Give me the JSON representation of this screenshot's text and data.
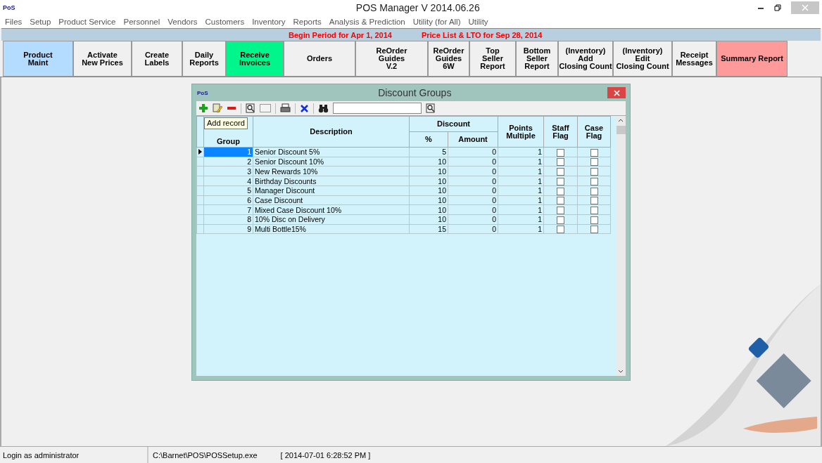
{
  "window": {
    "logo": "PoS",
    "title": "POS Manager V 2014.06.26"
  },
  "menu": [
    "Files",
    "Setup",
    "Product Service",
    "Personnel",
    "Vendors",
    "Customers",
    "Inventory",
    "Reports",
    "Analysis & Prediction",
    "Utility (for All)",
    "Utility"
  ],
  "period_banner": [
    "Begin Period for  Apr 1, 2014",
    "Price List & LTO for  Sep 28, 2014"
  ],
  "buttons": [
    {
      "lines": [
        "Product",
        "Maint"
      ],
      "color": "#b3dcff"
    },
    {
      "lines": [
        "Activate",
        "New Prices"
      ],
      "color": "#f0f0f0"
    },
    {
      "lines": [
        "Create",
        "Labels"
      ],
      "color": "#f0f0f0"
    },
    {
      "lines": [
        "Daily",
        "Reports"
      ],
      "color": "#f0f0f0"
    },
    {
      "lines": [
        "Receive",
        "Invoices"
      ],
      "color": "#00f58a"
    },
    {
      "lines": [
        "Orders"
      ],
      "color": "#f0f0f0"
    },
    {
      "lines": [
        "ReOrder",
        "Guides",
        "V.2"
      ],
      "color": "#f0f0f0"
    },
    {
      "lines": [
        "ReOrder",
        "Guides",
        "6W"
      ],
      "color": "#f0f0f0"
    },
    {
      "lines": [
        "Top",
        "Seller",
        "Report"
      ],
      "color": "#f0f0f0"
    },
    {
      "lines": [
        "Bottom",
        "Seller",
        "Report"
      ],
      "color": "#f0f0f0"
    },
    {
      "lines": [
        "(Inventory)",
        "Add",
        "Closing Count"
      ],
      "color": "#f0f0f0"
    },
    {
      "lines": [
        "(Inventory)",
        "Edit",
        "Closing Count"
      ],
      "color": "#f0f0f0"
    },
    {
      "lines": [
        "Receipt",
        "Messages"
      ],
      "color": "#f0f0f0"
    },
    {
      "lines": [
        "Summary Report"
      ],
      "color": "#ff9a9a"
    }
  ],
  "dialog": {
    "logo": "PoS",
    "title": "Discount Groups",
    "tooltip": "Add record",
    "columns": {
      "group": "Group",
      "description": "Description",
      "discount": "Discount",
      "percent": "%",
      "amount": "Amount",
      "points": "Points Multiple",
      "staff": "Staff Flag",
      "case": "Case Flag"
    },
    "rows": [
      {
        "group": "1",
        "description": "Senior Discount 5%",
        "percent": "5",
        "amount": "0",
        "points": "1",
        "staff_flag": false,
        "case_flag": false,
        "selected": true
      },
      {
        "group": "2",
        "description": "Senior Discount 10%",
        "percent": "10",
        "amount": "0",
        "points": "1",
        "staff_flag": false,
        "case_flag": false,
        "selected": false
      },
      {
        "group": "3",
        "description": "New Rewards 10%",
        "percent": "10",
        "amount": "0",
        "points": "1",
        "staff_flag": false,
        "case_flag": false,
        "selected": false
      },
      {
        "group": "4",
        "description": "Birthday Discounts",
        "percent": "10",
        "amount": "0",
        "points": "1",
        "staff_flag": false,
        "case_flag": false,
        "selected": false
      },
      {
        "group": "5",
        "description": "Manager Discount",
        "percent": "10",
        "amount": "0",
        "points": "1",
        "staff_flag": false,
        "case_flag": false,
        "selected": false
      },
      {
        "group": "6",
        "description": "Case Discount",
        "percent": "10",
        "amount": "0",
        "points": "1",
        "staff_flag": false,
        "case_flag": false,
        "selected": false
      },
      {
        "group": "7",
        "description": "Mixed Case Discount 10%",
        "percent": "10",
        "amount": "0",
        "points": "1",
        "staff_flag": false,
        "case_flag": false,
        "selected": false
      },
      {
        "group": "8",
        "description": "10% Disc on Delivery",
        "percent": "10",
        "amount": "0",
        "points": "1",
        "staff_flag": false,
        "case_flag": false,
        "selected": false
      },
      {
        "group": "9",
        "description": "Multi Bottle15%",
        "percent": "15",
        "amount": "0",
        "points": "1",
        "staff_flag": false,
        "case_flag": false,
        "selected": false
      }
    ]
  },
  "status_bar": {
    "login": "Login as administrator",
    "path": "C:\\Barnet\\POS\\POSSetup.exe",
    "timestamp": "[  2014-07-01 6:28:52 PM  ]"
  }
}
